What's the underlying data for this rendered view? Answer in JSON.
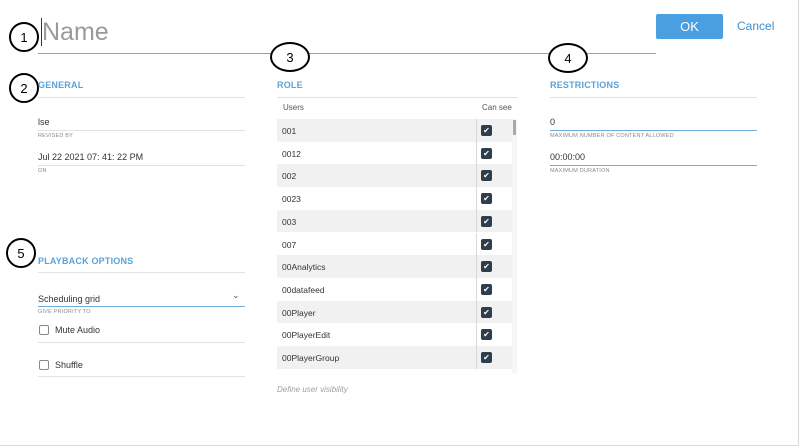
{
  "header": {
    "name_placeholder": "Name",
    "ok_label": "OK",
    "cancel_label": "Cancel"
  },
  "annotations": [
    "1",
    "2",
    "3",
    "4",
    "5"
  ],
  "general": {
    "title": "GENERAL",
    "revised_by_value": "lse",
    "revised_by_caption": "REVISED BY",
    "on_value": "Jul 22 2021 07: 41: 22 PM",
    "on_caption": "ON"
  },
  "playback": {
    "title": "PLAYBACK OPTIONS",
    "priority_value": "Scheduling grid",
    "priority_caption": "GIVE PRIORITY TO",
    "mute_label": "Mute Audio",
    "mute_checked": false,
    "shuffle_label": "Shuffle",
    "shuffle_checked": false
  },
  "role": {
    "title": "ROLE",
    "col_users": "Users",
    "col_can_see": "Can see",
    "rows": [
      {
        "user": "001",
        "can_see": true
      },
      {
        "user": "0012",
        "can_see": true
      },
      {
        "user": "002",
        "can_see": true
      },
      {
        "user": "0023",
        "can_see": true
      },
      {
        "user": "003",
        "can_see": true
      },
      {
        "user": "007",
        "can_see": true
      },
      {
        "user": "00Analytics",
        "can_see": true
      },
      {
        "user": "00datafeed",
        "can_see": true
      },
      {
        "user": "00Player",
        "can_see": true
      },
      {
        "user": "00PlayerEdit",
        "can_see": true
      },
      {
        "user": "00PlayerGroup",
        "can_see": true
      }
    ],
    "hint": "Define user visibility"
  },
  "restrictions": {
    "title": "RESTRICTIONS",
    "max_content_value": "0",
    "max_content_caption": "MAXIMUM NUMBER OF CONTENT ALLOWED",
    "max_duration_value": "00:00:00",
    "max_duration_caption": "MAXIMUM DURATION"
  },
  "colors": {
    "accent": "#5aa3d8",
    "button": "#4a9fe0",
    "checkbox_on": "#2e3e4c"
  },
  "icons": {
    "check": "checkmark-icon",
    "dropdown": "chevron-down-icon"
  }
}
